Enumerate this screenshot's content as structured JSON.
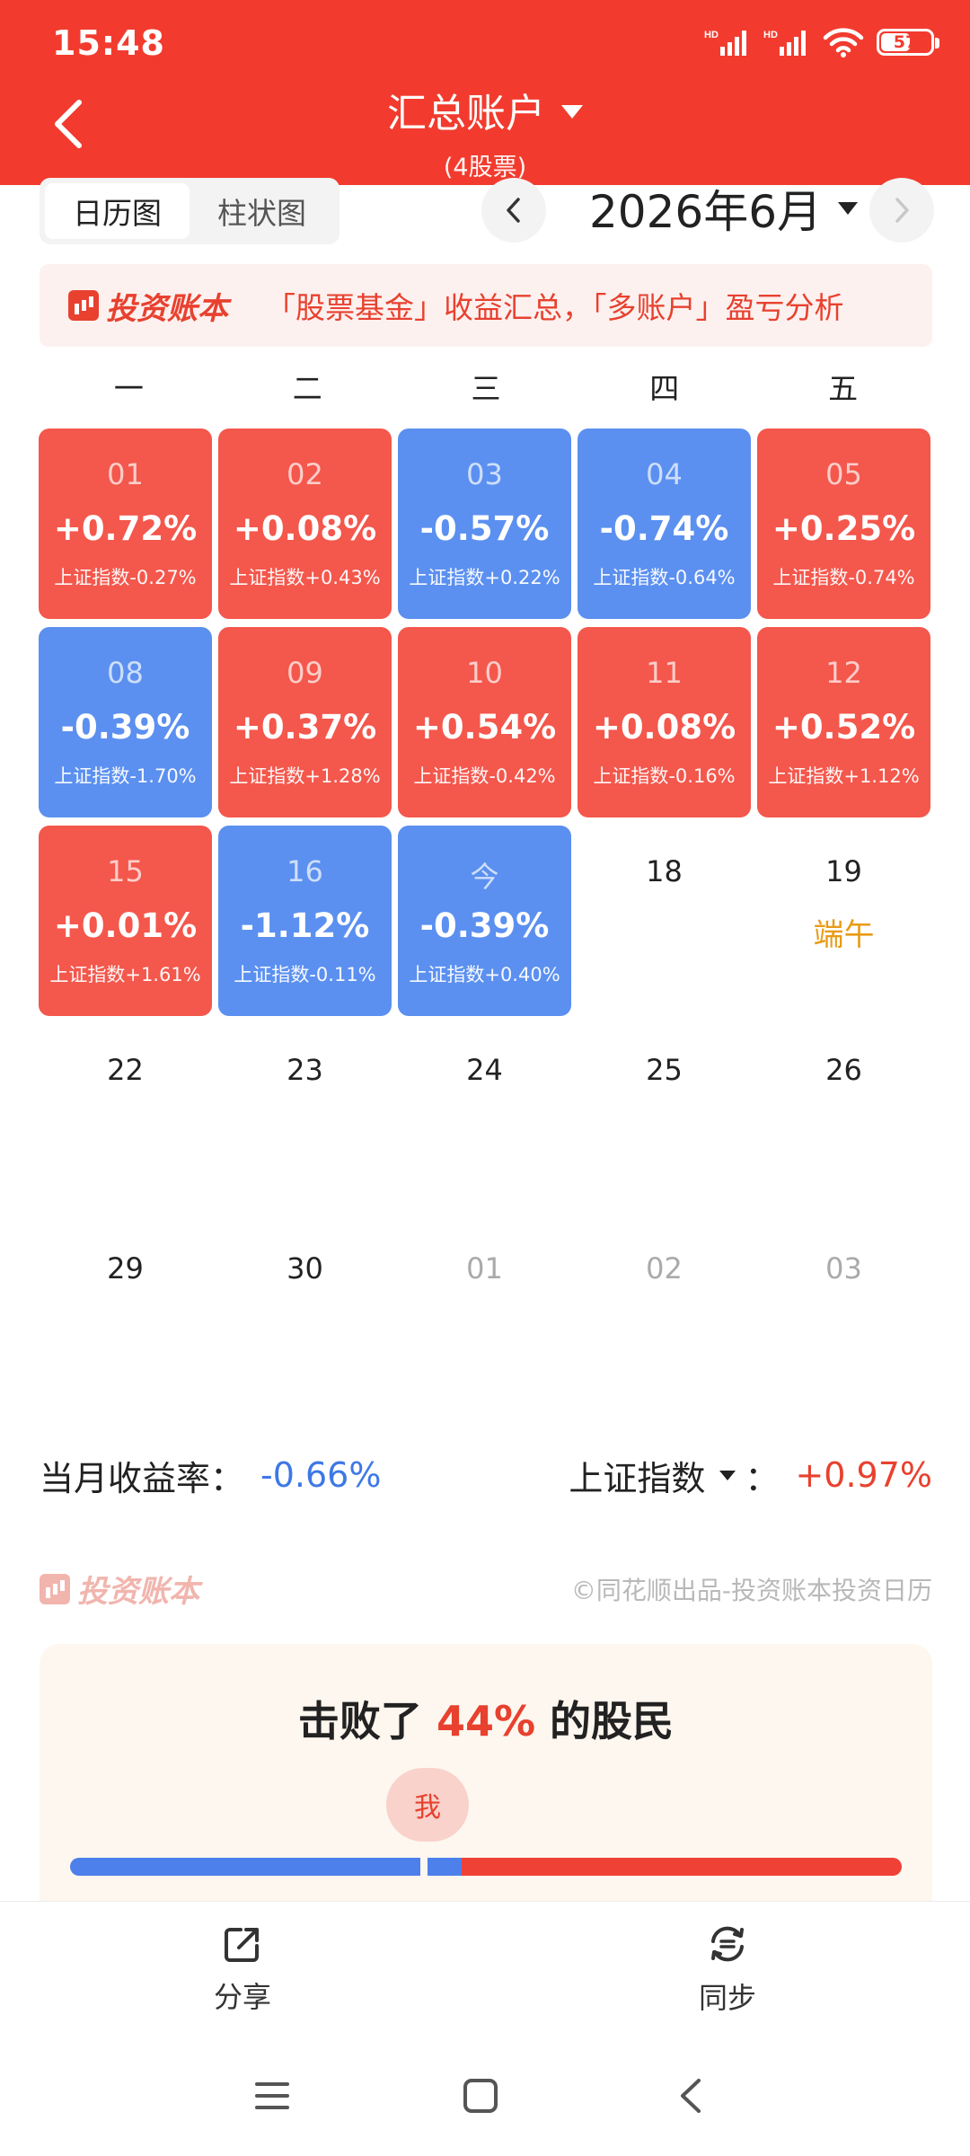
{
  "status": {
    "time": "15:48",
    "battery": "57",
    "net_1": "HD",
    "net_2": "HD"
  },
  "header": {
    "title": "汇总账户",
    "subtitle": "(4股票)"
  },
  "view_toggle": {
    "calendar": "日历图",
    "bar": "柱状图"
  },
  "month": {
    "label": "2026年6月"
  },
  "promo": {
    "brand": "投资账本",
    "text": "「股票基金」收益汇总，「多账户」盈亏分析"
  },
  "weekdays": [
    "一",
    "二",
    "三",
    "四",
    "五"
  ],
  "weeks": [
    [
      {
        "day": "01",
        "pct": "+0.72%",
        "index": "上证指数-0.27%",
        "trend": "up"
      },
      {
        "day": "02",
        "pct": "+0.08%",
        "index": "上证指数+0.43%",
        "trend": "up"
      },
      {
        "day": "03",
        "pct": "-0.57%",
        "index": "上证指数+0.22%",
        "trend": "down"
      },
      {
        "day": "04",
        "pct": "-0.74%",
        "index": "上证指数-0.64%",
        "trend": "down"
      },
      {
        "day": "05",
        "pct": "+0.25%",
        "index": "上证指数-0.74%",
        "trend": "up"
      }
    ],
    [
      {
        "day": "08",
        "pct": "-0.39%",
        "index": "上证指数-1.70%",
        "trend": "down"
      },
      {
        "day": "09",
        "pct": "+0.37%",
        "index": "上证指数+1.28%",
        "trend": "up"
      },
      {
        "day": "10",
        "pct": "+0.54%",
        "index": "上证指数-0.42%",
        "trend": "up"
      },
      {
        "day": "11",
        "pct": "+0.08%",
        "index": "上证指数-0.16%",
        "trend": "up"
      },
      {
        "day": "12",
        "pct": "+0.52%",
        "index": "上证指数+1.12%",
        "trend": "up"
      }
    ],
    [
      {
        "day": "15",
        "pct": "+0.01%",
        "index": "上证指数+1.61%",
        "trend": "up"
      },
      {
        "day": "16",
        "pct": "-1.12%",
        "index": "上证指数-0.11%",
        "trend": "down"
      },
      {
        "day": "今",
        "pct": "-0.39%",
        "index": "上证指数+0.40%",
        "trend": "down"
      },
      {
        "day": "18",
        "trend": "empty"
      },
      {
        "day": "19",
        "holiday": "端午",
        "trend": "empty"
      }
    ],
    [
      {
        "day": "22",
        "trend": "empty"
      },
      {
        "day": "23",
        "trend": "empty"
      },
      {
        "day": "24",
        "trend": "empty"
      },
      {
        "day": "25",
        "trend": "empty"
      },
      {
        "day": "26",
        "trend": "empty"
      }
    ],
    [
      {
        "day": "29",
        "trend": "empty"
      },
      {
        "day": "30",
        "trend": "empty"
      },
      {
        "day": "01",
        "trend": "empty",
        "other_month": true
      },
      {
        "day": "02",
        "trend": "empty",
        "other_month": true
      },
      {
        "day": "03",
        "trend": "empty",
        "other_month": true
      }
    ]
  ],
  "summary": {
    "month_label": "当月收益率：",
    "month_value": "-0.66%",
    "index_label": "上证指数",
    "index_colon": "：",
    "index_value": "+0.97%"
  },
  "watermark": {
    "brand": "投资账本",
    "credit": "©同花顺出品-投资账本投资日历"
  },
  "beat": {
    "prefix": "击败了 ",
    "percent": "44%",
    "suffix": " 的股民",
    "me": "我",
    "beat_fraction": 0.44
  },
  "actions": {
    "share": "分享",
    "sync": "同步"
  },
  "colors": {
    "header": "#f23b2e",
    "gain": "#f4574c",
    "loss": "#5b90f0",
    "holiday": "#e89b14"
  }
}
